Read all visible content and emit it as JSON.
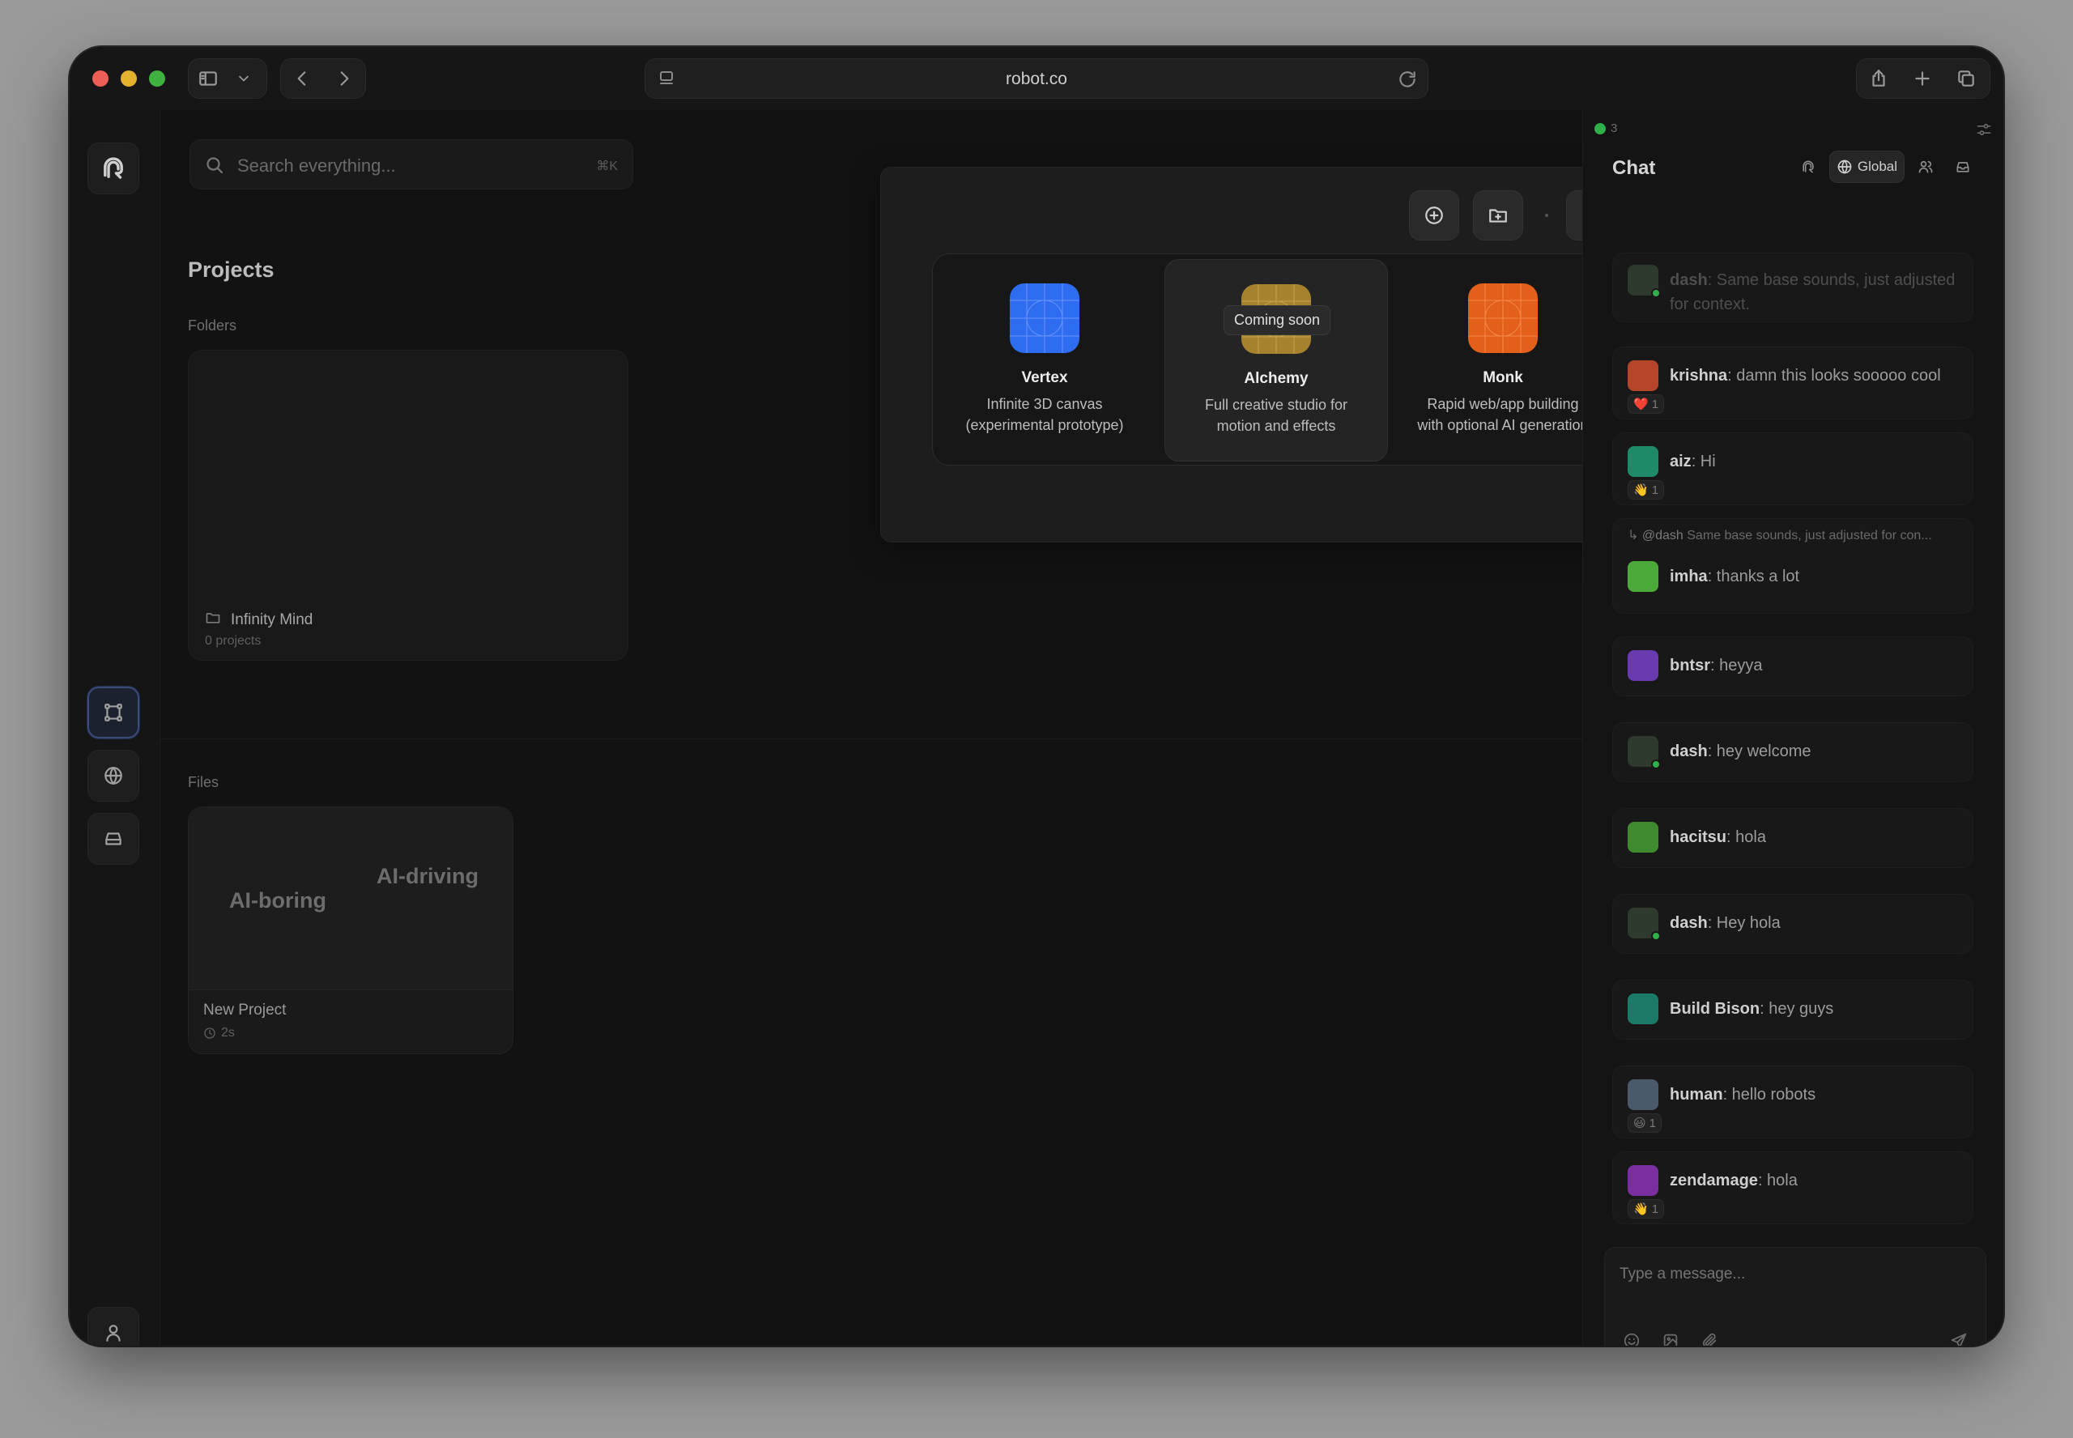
{
  "browser": {
    "url": "robot.co"
  },
  "search": {
    "placeholder": "Search everything...",
    "shortcut": "⌘K"
  },
  "projects": {
    "title": "Projects",
    "folders_label": "Folders",
    "folders": [
      {
        "name": "Infinity Mind",
        "count": "0 projects"
      }
    ],
    "files_label": "Files",
    "files": [
      {
        "name": "New Project",
        "age": "2s",
        "thumb_text_1": "AI-boring",
        "thumb_text_2": "AI-driving"
      }
    ]
  },
  "apps_panel": {
    "apps": [
      {
        "name": "Vertex",
        "desc_line1": "Infinite 3D canvas",
        "desc_line2": "(experimental prototype)",
        "color": "#2f6df0"
      },
      {
        "name": "Alchemy",
        "desc_line1": "Full creative studio for",
        "desc_line2": "motion and effects",
        "color": "#a6822e",
        "tooltip": "Coming soon"
      },
      {
        "name": "Monk",
        "desc_line1": "Rapid web/app building",
        "desc_line2": "with optional AI generation",
        "color": "#e2601a"
      }
    ]
  },
  "chat": {
    "online_count": "3",
    "title": "Chat",
    "tab_global": "Global",
    "messages": [
      {
        "user": "dash",
        "text": ": Same base sounds, just adjusted for context."
      },
      {
        "user": "krishna",
        "text": ": damn this looks sooooo cool",
        "reaction": "❤️",
        "reaction_count": "1"
      },
      {
        "user": "aiz",
        "text": ": Hi",
        "reaction": "👋",
        "reaction_count": "1"
      },
      {
        "reply_user": "@dash",
        "reply_text": " Same base sounds, just adjusted for con...",
        "user": "imha",
        "text": ": thanks a lot"
      },
      {
        "user": "bntsr",
        "text": ": heyya"
      },
      {
        "user": "dash",
        "text": ": hey welcome"
      },
      {
        "user": "hacitsu",
        "text": ": hola"
      },
      {
        "user": "dash",
        "text": ": Hey hola"
      },
      {
        "user": "Build Bison",
        "text": ": hey guys"
      },
      {
        "user": "human",
        "text": ": hello robots",
        "reaction": "😃",
        "reaction_count": "1"
      },
      {
        "user": "zendamage",
        "text": ": hola",
        "reaction": "👋",
        "reaction_count": "1"
      }
    ],
    "composer_placeholder": "Type a message..."
  }
}
